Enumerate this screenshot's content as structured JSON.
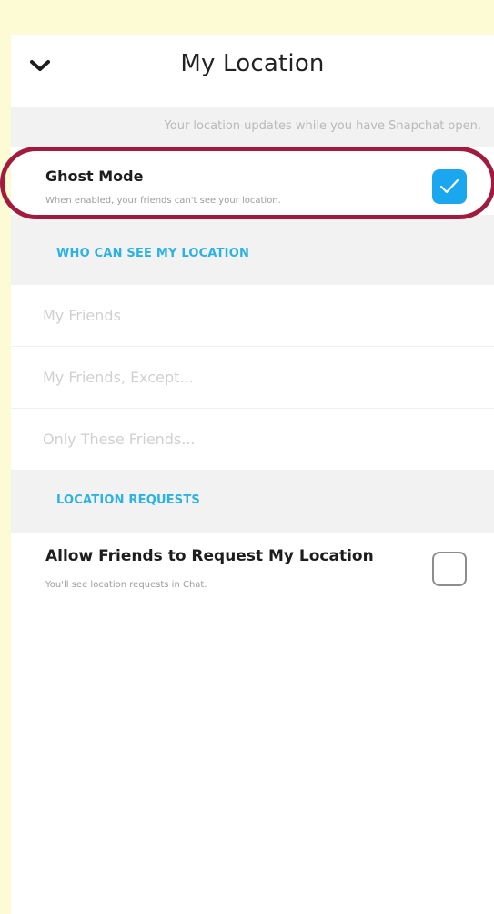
{
  "header": {
    "title": "My Location",
    "back_icon": "chevron-down-icon"
  },
  "info_text": "Your location updates while you have Snapchat open.",
  "ghost_mode": {
    "title": "Ghost Mode",
    "subtitle": "When enabled, your friends can't see your location.",
    "checked": true
  },
  "who_section": {
    "label": "WHO CAN SEE MY LOCATION",
    "options": [
      "My Friends",
      "My Friends, Except...",
      "Only These Friends..."
    ]
  },
  "requests_section": {
    "label": "LOCATION REQUESTS",
    "allow": {
      "title": "Allow Friends to Request My Location",
      "subtitle": "You'll see location requests in Chat.",
      "checked": false
    }
  },
  "colors": {
    "page_background": "#fdfbd3",
    "accent_blue": "#1aa7f0",
    "section_label": "#2bb2e4",
    "highlight_ring": "#a21a3d"
  }
}
